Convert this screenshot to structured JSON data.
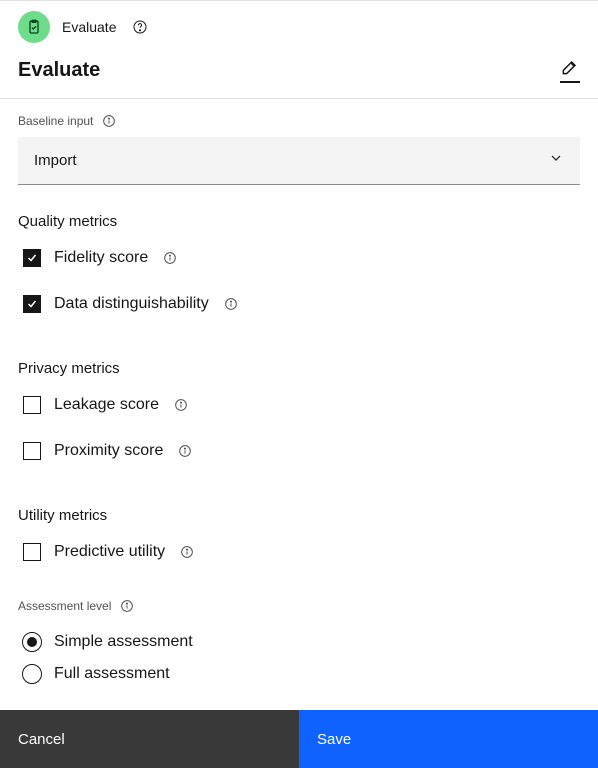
{
  "crumb": {
    "label": "Evaluate"
  },
  "page_title": "Evaluate",
  "baseline": {
    "label": "Baseline input",
    "selected": "Import"
  },
  "sections": {
    "quality": {
      "heading": "Quality metrics",
      "items": [
        {
          "label": "Fidelity score",
          "checked": true
        },
        {
          "label": "Data distinguishability",
          "checked": true
        }
      ]
    },
    "privacy": {
      "heading": "Privacy metrics",
      "items": [
        {
          "label": "Leakage score",
          "checked": false
        },
        {
          "label": "Proximity score",
          "checked": false
        }
      ]
    },
    "utility": {
      "heading": "Utility metrics",
      "items": [
        {
          "label": "Predictive utility",
          "checked": false
        }
      ]
    }
  },
  "assessment": {
    "label": "Assessment level",
    "options": [
      {
        "label": "Simple assessment",
        "selected": true
      },
      {
        "label": "Full assessment",
        "selected": false
      }
    ]
  },
  "footer": {
    "cancel": "Cancel",
    "save": "Save"
  }
}
